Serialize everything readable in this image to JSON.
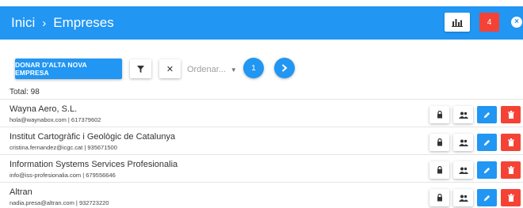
{
  "colors": {
    "primary": "#2196f3",
    "danger": "#f44336",
    "text": "#333333"
  },
  "header": {
    "breadcrumb": [
      {
        "label": "Inici"
      },
      {
        "label": "Empreses"
      }
    ],
    "separator": "›",
    "stats_icon": "bar-chart-icon",
    "notification_count": "4",
    "close_icon": "close-circle-icon"
  },
  "toolbar": {
    "add_label": "DONAR D'ALTA NOVA EMPRESA",
    "filter_icon": "filter-icon",
    "clear_icon": "close-icon",
    "order_placeholder": "Ordenar...",
    "page": "1",
    "next_icon": "chevron-right-icon"
  },
  "total_label": "Total: 98",
  "companies": [
    {
      "name": "Wayna Aero, S.L.",
      "contact": "hola@waynabox.com | 617379602"
    },
    {
      "name": "Institut Cartogràfic i Geològic de Catalunya",
      "contact": "cristina.fernandez@icgc.cat | 935671500"
    },
    {
      "name": "Information Systems Services Profesionalia",
      "contact": "info@iss-profesionalia.com | 679556646"
    },
    {
      "name": "Altran",
      "contact": "nadia.presa@altran.com | 932723220"
    }
  ],
  "row_actions": [
    "lock-icon",
    "users-icon",
    "pencil-icon",
    "trash-icon"
  ]
}
